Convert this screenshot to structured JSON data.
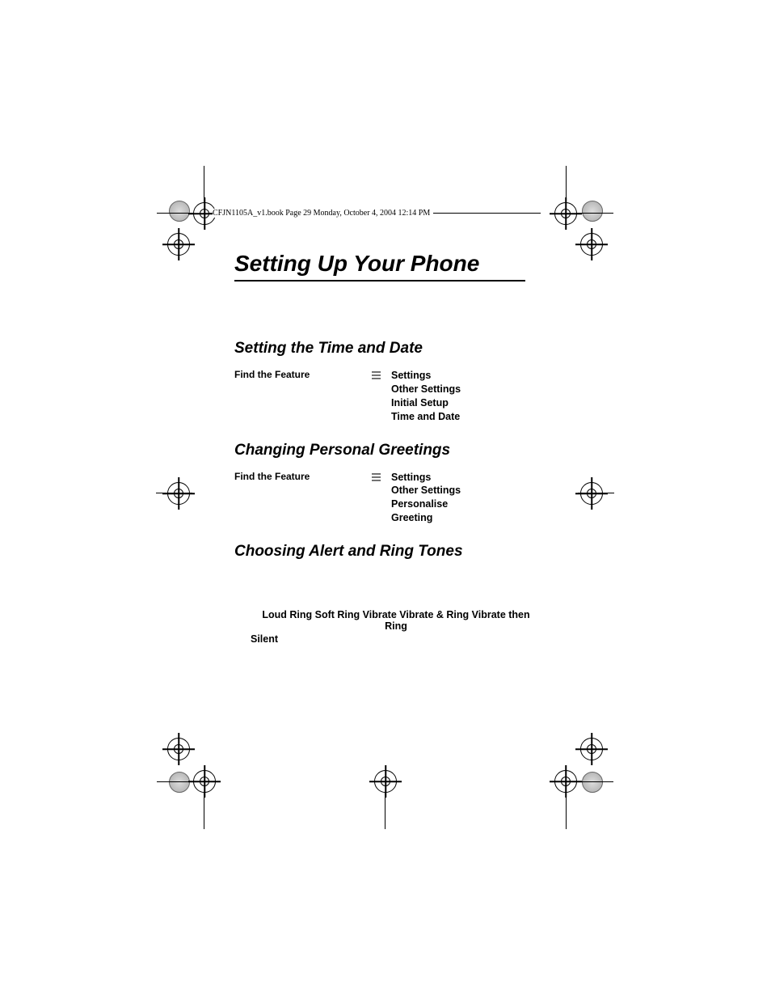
{
  "header": {
    "runner": "CFJN1105A_v1.book  Page 29  Monday, October 4, 2004  12:14 PM"
  },
  "page": {
    "title": "Setting Up Your Phone"
  },
  "sections": {
    "time_date": {
      "heading": "Setting the Time and Date",
      "find_label": "Find the Feature",
      "path": {
        "p0": "Settings",
        "p1": "Other Settings",
        "p2": "Initial Setup",
        "p3": "Time and Date"
      }
    },
    "greetings": {
      "heading": "Changing Personal Greetings",
      "find_label": "Find the Feature",
      "path": {
        "p0": "Settings",
        "p1": "Other Settings",
        "p2": "Personalise",
        "p3": "Greeting"
      }
    },
    "alert_tones": {
      "heading": "Choosing Alert and Ring Tones",
      "options_line1": "Loud Ring   Soft Ring   Vibrate   Vibrate & Ring   Vibrate then Ring",
      "options_line2": "Silent"
    }
  }
}
